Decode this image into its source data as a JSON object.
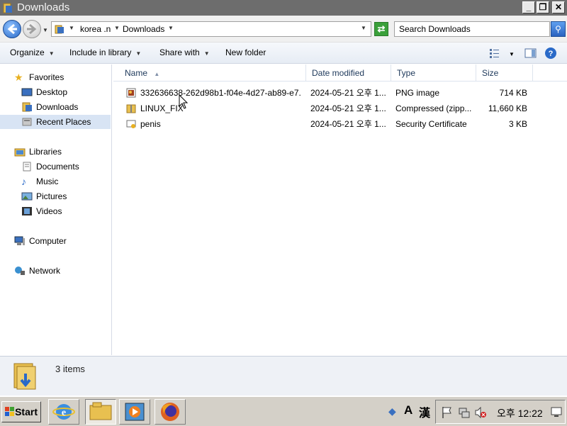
{
  "window": {
    "title": "Downloads",
    "controls": {
      "minimize": "_",
      "maximize": "❐",
      "close": "✕"
    }
  },
  "address": {
    "crumbs": [
      "korea .n",
      "Downloads"
    ],
    "search_placeholder": "Search Downloads"
  },
  "commands": {
    "organize": "Organize",
    "include_in_library": "Include in library",
    "share_with": "Share with",
    "new_folder": "New folder"
  },
  "nav": {
    "favorites": {
      "label": "Favorites",
      "items": [
        "Desktop",
        "Downloads",
        "Recent Places"
      ]
    },
    "libraries": {
      "label": "Libraries",
      "items": [
        "Documents",
        "Music",
        "Pictures",
        "Videos"
      ]
    },
    "computer": "Computer",
    "network": "Network"
  },
  "columns": {
    "name": "Name",
    "date": "Date modified",
    "type": "Type",
    "size": "Size"
  },
  "files": [
    {
      "name": "332636638-262d98b1-f04e-4d27-ab89-e7...",
      "date": "2024-05-21 오후 1...",
      "type": "PNG image",
      "size": "714 KB",
      "icon": "png-image-icon"
    },
    {
      "name": "LINUX_FIX",
      "date": "2024-05-21 오후 1...",
      "type": "Compressed (zipp...",
      "size": "11,660 KB",
      "icon": "zip-folder-icon"
    },
    {
      "name": "penis",
      "date": "2024-05-21 오후 1...",
      "type": "Security Certificate",
      "size": "3 KB",
      "icon": "certificate-icon"
    }
  ],
  "details": {
    "count": "3 items"
  },
  "taskbar": {
    "start": "Start",
    "ime": {
      "lang": "A",
      "hanja": "漢"
    },
    "clock": "오후 12:22"
  }
}
